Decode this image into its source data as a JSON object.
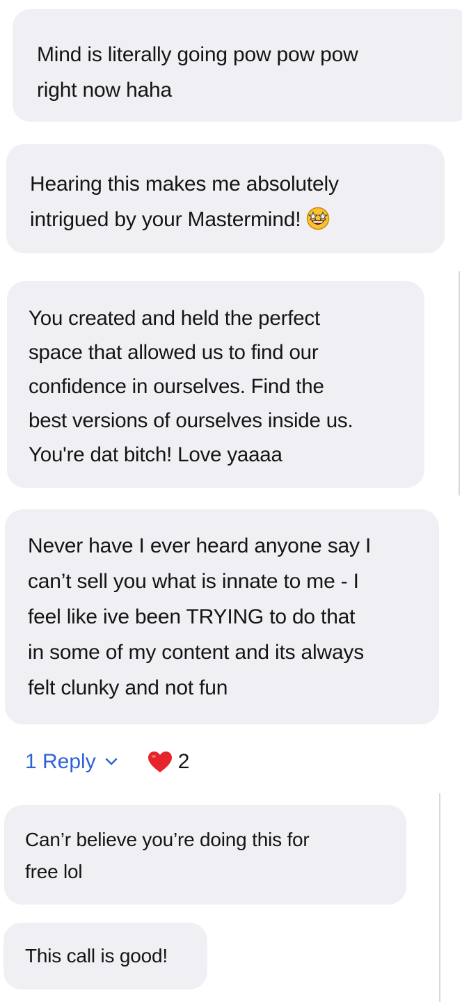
{
  "messages": [
    {
      "text": "Mind is literally going pow pow pow\nright now haha"
    },
    {
      "text": "Hearing this makes me absolutely\nintrigued by your Mastermind!",
      "emoji": "star-struck-emoji-icon"
    },
    {
      "text": "You created and held the perfect\nspace that allowed us to find our\nconfidence in ourselves. Find the\nbest versions of ourselves inside us.\nYou're dat bitch! Love yaaaa"
    },
    {
      "text": "Never have I ever heard anyone say I\ncan’t sell you what is innate to me - I\nfeel like ive been TRYING to do that\nin some of my content and its always\nfelt clunky and not fun"
    },
    {
      "text": "Can’r believe you’re doing this for\nfree lol"
    },
    {
      "text": "This call is good!"
    }
  ],
  "reactions": {
    "reply_label": "1 Reply",
    "reply_icon": "chevron-down-icon",
    "like_icon": "heart-icon",
    "like_count": "2"
  },
  "colors": {
    "bubble_bg": "#f0f0f4",
    "reply_link": "#2f62d6",
    "heart": "#e5242b"
  }
}
